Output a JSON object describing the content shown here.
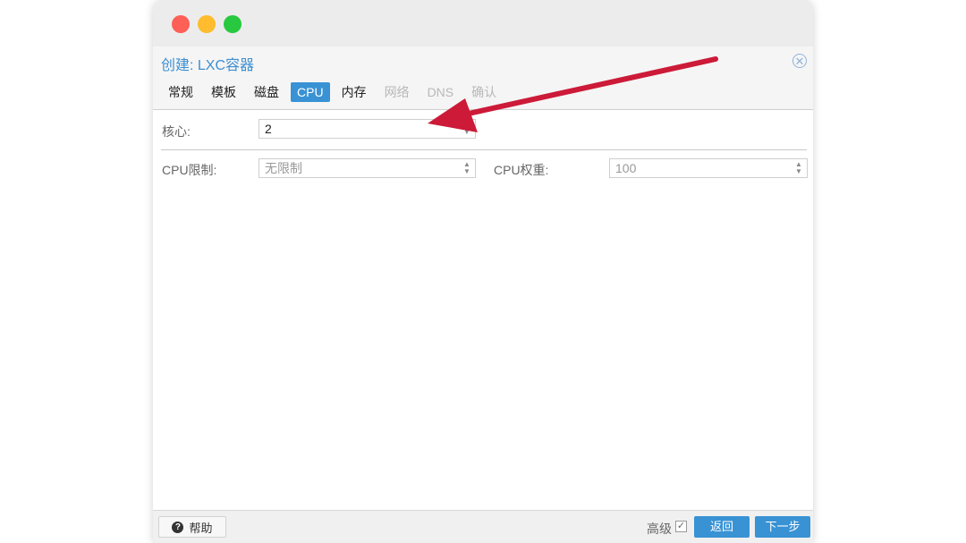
{
  "dialog": {
    "title": "创建: LXC容器",
    "close_icon": "close-icon"
  },
  "tabs": [
    {
      "label": "常规",
      "state": "normal"
    },
    {
      "label": "模板",
      "state": "normal"
    },
    {
      "label": "磁盘",
      "state": "normal"
    },
    {
      "label": "CPU",
      "state": "active"
    },
    {
      "label": "内存",
      "state": "normal"
    },
    {
      "label": "网络",
      "state": "disabled"
    },
    {
      "label": "DNS",
      "state": "disabled"
    },
    {
      "label": "确认",
      "state": "disabled"
    }
  ],
  "form": {
    "cores_label": "核心:",
    "cores_value": "2",
    "cpu_limit_label": "CPU限制:",
    "cpu_limit_placeholder": "无限制",
    "cpu_weight_label": "CPU权重:",
    "cpu_weight_value": "100"
  },
  "footer": {
    "help_label": "帮助",
    "advanced_label": "高级",
    "advanced_checked": true,
    "back_label": "返回",
    "next_label": "下一步"
  },
  "colors": {
    "accent": "#3892d4",
    "annotation_arrow": "#cc1a38"
  }
}
